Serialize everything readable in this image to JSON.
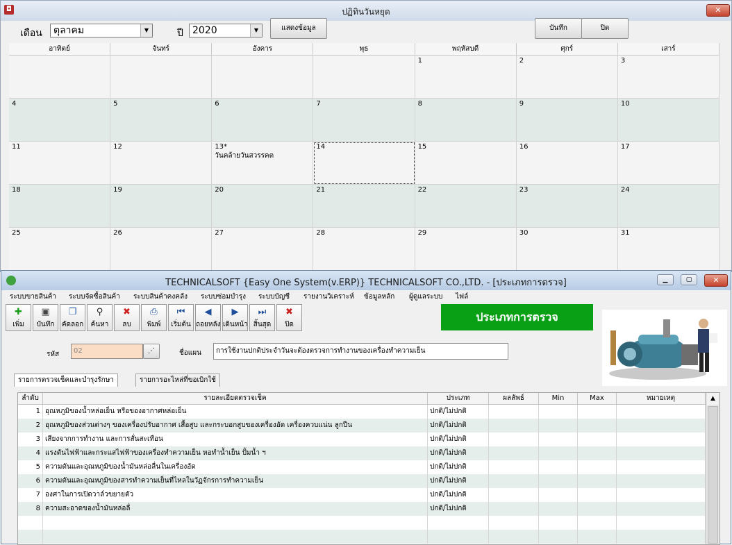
{
  "calendar_window": {
    "title": "ปฏิทินวันหยุด",
    "close_label": "✕",
    "month_label": "เดือน",
    "month_value": "ตุลาคม",
    "year_label": "ปี",
    "year_value": "2020",
    "show_button": "แสดงข้อมูล",
    "save_button": "บันทึก",
    "close_button": "ปิด",
    "weekdays": [
      "อาทิตย์",
      "จันทร์",
      "อังคาร",
      "พุธ",
      "พฤหัสบดี",
      "ศุกร์",
      "เสาร์"
    ],
    "weeks": [
      [
        "",
        "",
        "",
        "",
        "1",
        "2",
        "3"
      ],
      [
        "4",
        "5",
        "6",
        "7",
        "8",
        "9",
        "10"
      ],
      [
        "11",
        "12",
        "13*",
        "14",
        "15",
        "16",
        "17"
      ],
      [
        "18",
        "19",
        "20",
        "21",
        "22",
        "23",
        "24"
      ],
      [
        "25",
        "26",
        "27",
        "28",
        "29",
        "30",
        "31"
      ]
    ],
    "holiday_note": "วันคล้ายวันสวรรคต",
    "selected_day": "14"
  },
  "erp_window": {
    "title": "TECHNICALSOFT {Easy One System(v.ERP)}  TECHNICALSOFT CO.,LTD. - [ประเภทการตรวจ]",
    "menu": [
      "ระบบขายสินค้า",
      "ระบบจัดซื้อสินค้า",
      "ระบบสินค้าคงคลัง",
      "ระบบซ่อมบำรุง",
      "ระบบบัญชี",
      "รายงานวิเคราะห์",
      "ข้อมูลหลัก",
      "ผู้ดูแลระบบ",
      "ไฟล์"
    ],
    "toolbar": [
      {
        "label": "เพิ่ม",
        "icon": "add-icon",
        "glyph": "✚",
        "color": "#1e9a1e"
      },
      {
        "label": "บันทึก",
        "icon": "save-icon",
        "glyph": "▣",
        "color": "#444444"
      },
      {
        "label": "คัดลอก",
        "icon": "copy-icon",
        "glyph": "❐",
        "color": "#2a5aa8"
      },
      {
        "label": "ค้นหา",
        "icon": "binoculars-icon",
        "glyph": "⚲",
        "color": "#222222"
      },
      {
        "label": "ลบ",
        "icon": "delete-icon",
        "glyph": "✖",
        "color": "#d02020"
      },
      {
        "label": "พิมพ์",
        "icon": "print-icon",
        "glyph": "⎙",
        "color": "#1f4f9a"
      },
      {
        "label": "เริ่มต้น",
        "icon": "first-record-icon",
        "glyph": "⏮",
        "color": "#1f4f9a"
      },
      {
        "label": "ถอยหลัง",
        "icon": "previous-record-icon",
        "glyph": "◀",
        "color": "#1f4f9a"
      },
      {
        "label": "เดินหน้า",
        "icon": "next-record-icon",
        "glyph": "▶",
        "color": "#1f4f9a"
      },
      {
        "label": "สิ้นสุด",
        "icon": "last-record-icon",
        "glyph": "⏭",
        "color": "#1f4f9a"
      },
      {
        "label": "ปิด",
        "icon": "close-circle-icon",
        "glyph": "✖",
        "color": "#c62020"
      }
    ],
    "form_title": "ประเภทการตรวจ",
    "code_label": "รหัส",
    "code_value": "02",
    "plan_label": "ชื่อแผน",
    "plan_value": "การใช้งานปกติประจำวันจะต้องตรวจการทำงานของเครื่องทำความเย็น",
    "tabs": [
      "รายการตรวจเช็คและบำรุงรักษา",
      "รายการอะไหล่ที่ขอเบิกใช้"
    ],
    "columns": [
      "ลำดับ",
      "รายละเอียดตรวจเช็ค",
      "ประเภท",
      "ผลลัพธ์",
      "Min",
      "Max",
      "หมายเหตุ"
    ],
    "rows": [
      {
        "no": "1",
        "detail": "อุณหภูมิของน้ำหล่อเย็น หรือของอากาศหล่อเย็น",
        "type": "ปกติ/ไม่ปกติ"
      },
      {
        "no": "2",
        "detail": "อุณหภูมิของส่วนต่างๆ ของเครื่องปรับอากาศ เสื้อสูบ และกระบอกสูบของเครื่องอัด เครื่องควบแน่น ลูกปืน",
        "type": "ปกติ/ไม่ปกติ"
      },
      {
        "no": "3",
        "detail": "เสียงจากการทำงาน และการสั่นสะเทือน",
        "type": "ปกติ/ไม่ปกติ"
      },
      {
        "no": "4",
        "detail": "แรงดันไฟฟ้าและกระแสไฟฟ้าของเครื่องทำความเย็น หอทำน้ำเย็น ปั้มน้ำ ฯ",
        "type": "ปกติ/ไม่ปกติ"
      },
      {
        "no": "5",
        "detail": "ความดันและอุณหภูมิของน้ำมันหล่อลื่นในเครื่องอัด",
        "type": "ปกติ/ไม่ปกติ"
      },
      {
        "no": "6",
        "detail": "ความดันและอุณหภูมิของสารทำความเย็นที่ไหลในวัฏจักรการทำความเย็น",
        "type": "ปกติ/ไม่ปกติ"
      },
      {
        "no": "7",
        "detail": "องศาในการเปิดวาล์วขยายตัว",
        "type": "ปกติ/ไม่ปกติ"
      },
      {
        "no": "8",
        "detail": "ความสะอาดของน้ำมันหล่อลื่",
        "type": "ปกติ/ไม่ปกติ"
      }
    ]
  }
}
